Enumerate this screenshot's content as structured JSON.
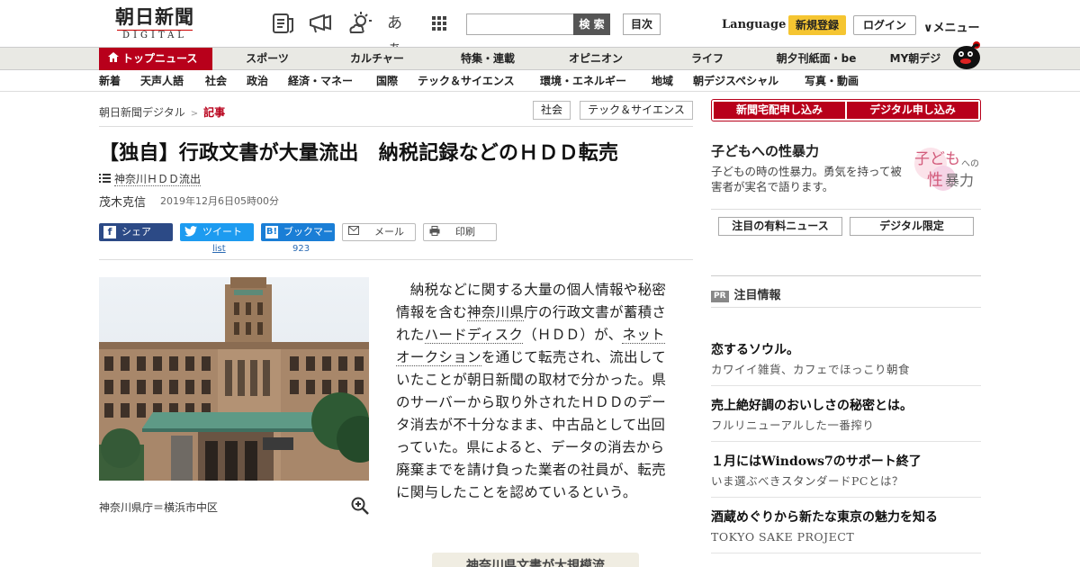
{
  "header": {
    "logo_jp": "朝日新聞",
    "logo_en": "DIGITAL",
    "icons": [
      "newspaper-icon",
      "megaphone-icon",
      "weather-icon",
      "font-size-icon",
      "apps-grid-icon"
    ],
    "font_icon_text": "あぁ",
    "search_placeholder": "",
    "search_label": "検 索",
    "toc_label": "目次",
    "language_label": "Language",
    "register_label": "新規登録",
    "login_label": "ログイン",
    "menu_label": "∨メニュー"
  },
  "nav_primary": {
    "top_label": "トップニュース",
    "items": [
      "スポーツ",
      "カルチャー",
      "特集・連載",
      "オピニオン",
      "ライフ",
      "朝夕刊紙面・be",
      "MY朝デジ"
    ]
  },
  "nav_secondary": {
    "items": [
      "新着",
      "天声人語",
      "社会",
      "政治",
      "経済・マネー",
      "国際",
      "テック＆サイエンス",
      "環境・エネルギー",
      "地域",
      "朝デジスペシャル",
      "写真・動画"
    ]
  },
  "breadcrumb": {
    "home": "朝日新聞デジタル",
    "separator": ">",
    "current": "記事"
  },
  "tags": [
    "社会",
    "テック＆サイエンス"
  ],
  "article": {
    "title": "【独自】行政文書が大量流出　納税記録などのＨＤＤ転売",
    "series": "神奈川ＨＤＤ流出",
    "author": "茂木克信",
    "date": "2019年12月6日05時00分",
    "photo_caption": "神奈川県庁＝横浜市中区",
    "body_1": "　納税などに関する大量の個人情報や秘密情報を含む",
    "link_1": "神奈川県",
    "body_2": "庁の行政文書が蓄積された",
    "link_2": "ハードディスク",
    "body_3": "（ＨＤＤ）が、",
    "link_3": "ネットオークション",
    "body_4": "を通じて転売され、流出していたことが朝日新聞の取材で分かった。県のサーバーから取り外されたＨＤＤのデータ消去が不十分なまま、中古品として出回っていた。県によると、データの消去から廃棄までを請け負った業者の社員が、転売に関与したことを認めているという。",
    "related_box": "神奈川県文書が大規模流"
  },
  "share": {
    "facebook": "シェア",
    "twitter": "ツイート",
    "twitter_count": "list",
    "hatena": "ブックマーク",
    "hatena_count": "923",
    "mail": "メール",
    "print": "印刷"
  },
  "sidebar": {
    "subscribe_paper": "新聞宅配申し込み",
    "subscribe_digital": "デジタル申し込み",
    "promo_title": "子どもへの性暴力",
    "promo_desc": "子どもの時の性暴力。勇気を持って被害者が実名で語ります。",
    "promo_logo_lines": [
      "子ども",
      "への",
      "性",
      "暴力"
    ],
    "pill_paid_news": "注目の有料ニュース",
    "pill_digital_only": "デジタル限定",
    "pr_badge": "PR",
    "pr_heading": "注目情報",
    "pr_items": [
      {
        "title": "恋するソウル。",
        "sub": "カワイイ雑貨、カフェでほっこり朝食"
      },
      {
        "title": "売上絶好調のおいしさの秘密とは。",
        "sub": "フルリニューアルした一番搾り"
      },
      {
        "title": "１月にはWindows7のサポート終了",
        "sub": "いま選ぶべきスタンダードPCとは？"
      },
      {
        "title": "酒蔵めぐりから新たな東京の魅力を知る",
        "sub": "TOKYO SAKE PROJECT"
      }
    ]
  },
  "colors": {
    "brand_red": "#b8001b",
    "register_yellow": "#f5c531",
    "facebook_blue": "#2c4a86",
    "twitter_blue": "#1d9bf0",
    "hatena_blue": "#1a7ed6"
  }
}
